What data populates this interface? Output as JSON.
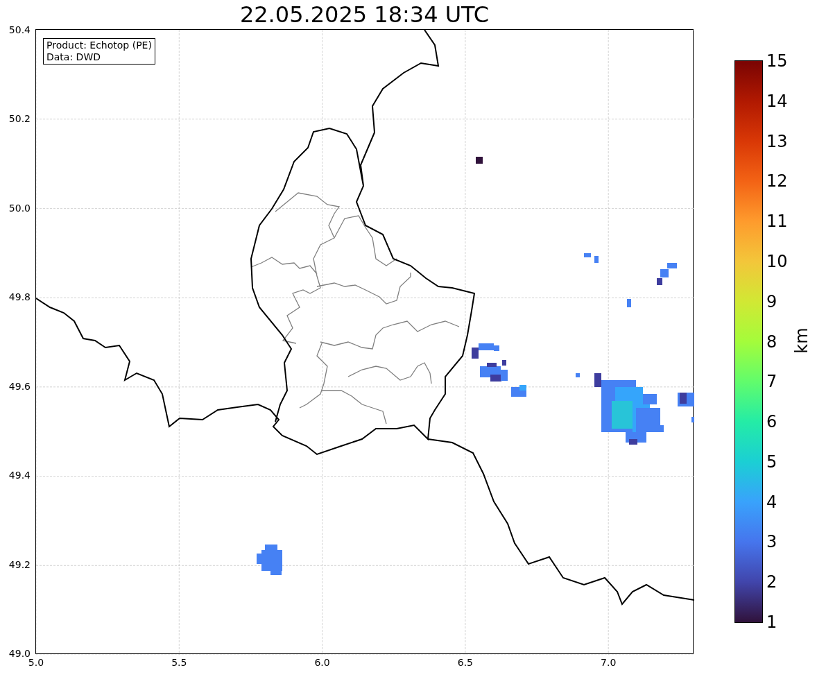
{
  "title": "22.05.2025 18:34 UTC",
  "legend": [
    "Product: Echotop (PE)",
    "Data: DWD"
  ],
  "x_ticks": [
    "5.0",
    "5.5",
    "6.0",
    "6.5",
    "7.0"
  ],
  "y_ticks": [
    "50.4",
    "50.2",
    "50.0",
    "49.8",
    "49.6",
    "49.4",
    "49.2",
    "49.0"
  ],
  "colorbar": {
    "label": "km",
    "ticks": [
      "15",
      "14",
      "13",
      "12",
      "11",
      "10",
      "9",
      "8",
      "7",
      "6",
      "5",
      "4",
      "3",
      "2",
      "1"
    ]
  }
}
